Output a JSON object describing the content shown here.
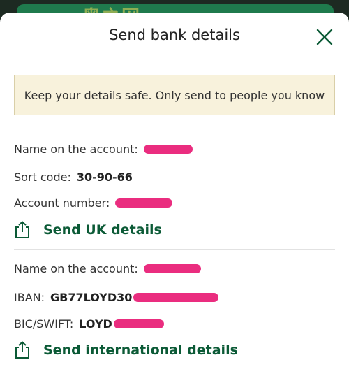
{
  "watermark": "奥之网",
  "sheet": {
    "title": "Send bank details"
  },
  "warning": {
    "text": "Keep your details safe. Only send to people you know"
  },
  "uk": {
    "name_label": "Name on the account:",
    "sort_code_label": "Sort code:",
    "sort_code_value": "30-90-66",
    "account_number_label": "Account number:",
    "send_label": "Send UK details"
  },
  "international": {
    "name_label": "Name on the account:",
    "iban_label": "IBAN:",
    "iban_visible": "GB77LOYD30",
    "bic_label": "BIC/SWIFT:",
    "bic_visible": "LOYD",
    "send_label": "Send international details"
  },
  "colors": {
    "accent_green": "#0b5a36",
    "warning_bg": "#f8f2dc",
    "redaction": "#ea2d7f"
  },
  "icons": {
    "close": "close-icon",
    "share": "share-icon"
  }
}
